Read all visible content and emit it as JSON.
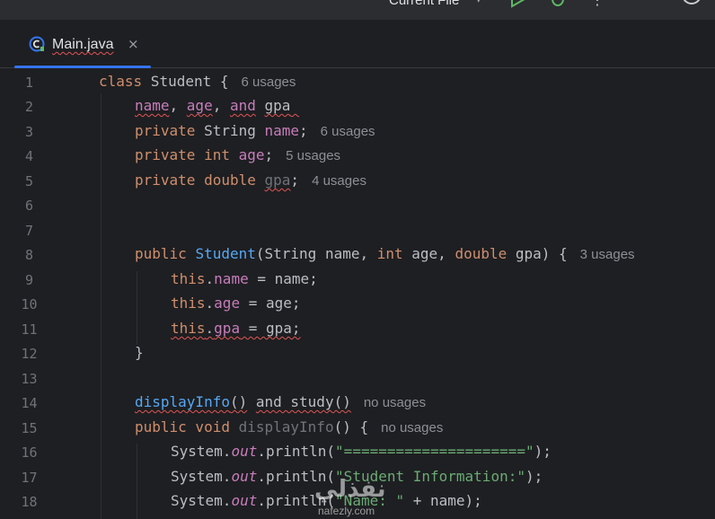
{
  "toolbar": {
    "run_config": "Current File",
    "icons": [
      "chevron-down-icon",
      "run-icon",
      "debug-icon",
      "more-icon",
      "account-icon"
    ]
  },
  "tabs": [
    {
      "label": "Main.java",
      "icon": "java-class-icon",
      "close": "×",
      "active": true
    }
  ],
  "watermark": {
    "arabic": "نفذلي",
    "latin": "nafezly.com"
  },
  "lines": [
    {
      "n": "1"
    },
    {
      "n": "2"
    },
    {
      "n": "3"
    },
    {
      "n": "4"
    },
    {
      "n": "5"
    },
    {
      "n": "6"
    },
    {
      "n": "7"
    },
    {
      "n": "8"
    },
    {
      "n": "9"
    },
    {
      "n": "10"
    },
    {
      "n": "11"
    },
    {
      "n": "12"
    },
    {
      "n": "13"
    },
    {
      "n": "14"
    },
    {
      "n": "15"
    },
    {
      "n": "16"
    },
    {
      "n": "17"
    },
    {
      "n": "18"
    }
  ],
  "code": {
    "l1": {
      "kw": "class",
      "name": " Student {",
      "hint": "6 usages"
    },
    "l2": {
      "a": "name",
      "sep1": ", ",
      "b": "age",
      "sep2": ", ",
      "c": "and",
      "sp": " ",
      "d": "gpa",
      "tail": " "
    },
    "l3": {
      "kw": "private",
      "type": " String ",
      "fld": "name",
      "semi": ";",
      "hint": "6 usages"
    },
    "l4": {
      "kw": "private",
      "type": " int",
      "sp": " ",
      "fld": "age",
      "semi": ";",
      "hint": "5 usages"
    },
    "l5": {
      "kw": "private",
      "type": " double",
      "sp": " ",
      "fld": "gpa",
      "semi": ";",
      "hint": "4 usages"
    },
    "l8": {
      "kw": "public",
      "sp": " ",
      "fn": "Student",
      "p1": "(String name, ",
      "k2": "int",
      "p2": " age, ",
      "k3": "double",
      "p3": " gpa) {",
      "hint": "3 usages"
    },
    "l9": {
      "kw": "this",
      "dot": ".",
      "fld": "name",
      "rest": " = name;"
    },
    "l10": {
      "kw": "this",
      "dot": ".",
      "fld": "age",
      "rest": " = age;"
    },
    "l11": {
      "kw": "this",
      "dot": ".",
      "fld": "gpa",
      "rest": " = gpa;"
    },
    "l12": {
      "text": "}"
    },
    "l14": {
      "a": "displayInfo",
      "b": "()",
      "c": " ",
      "d": "and study()",
      "hint": "no usages"
    },
    "l15": {
      "kw": "public void",
      "sp": " ",
      "fn": "displayInfo",
      "rest": "() {",
      "hint": "no usages"
    },
    "l16": {
      "sys": "System.",
      "out": "out",
      "call": ".println(",
      "str": "\"=====================\"",
      "end": ");"
    },
    "l17": {
      "sys": "System.",
      "out": "out",
      "call": ".println(",
      "str": "\"Student Information:\"",
      "end": ");"
    },
    "l18": {
      "sys": "System.",
      "out": "out",
      "call": ".println(",
      "str": "\"Name: \"",
      "end": " + name);"
    }
  }
}
